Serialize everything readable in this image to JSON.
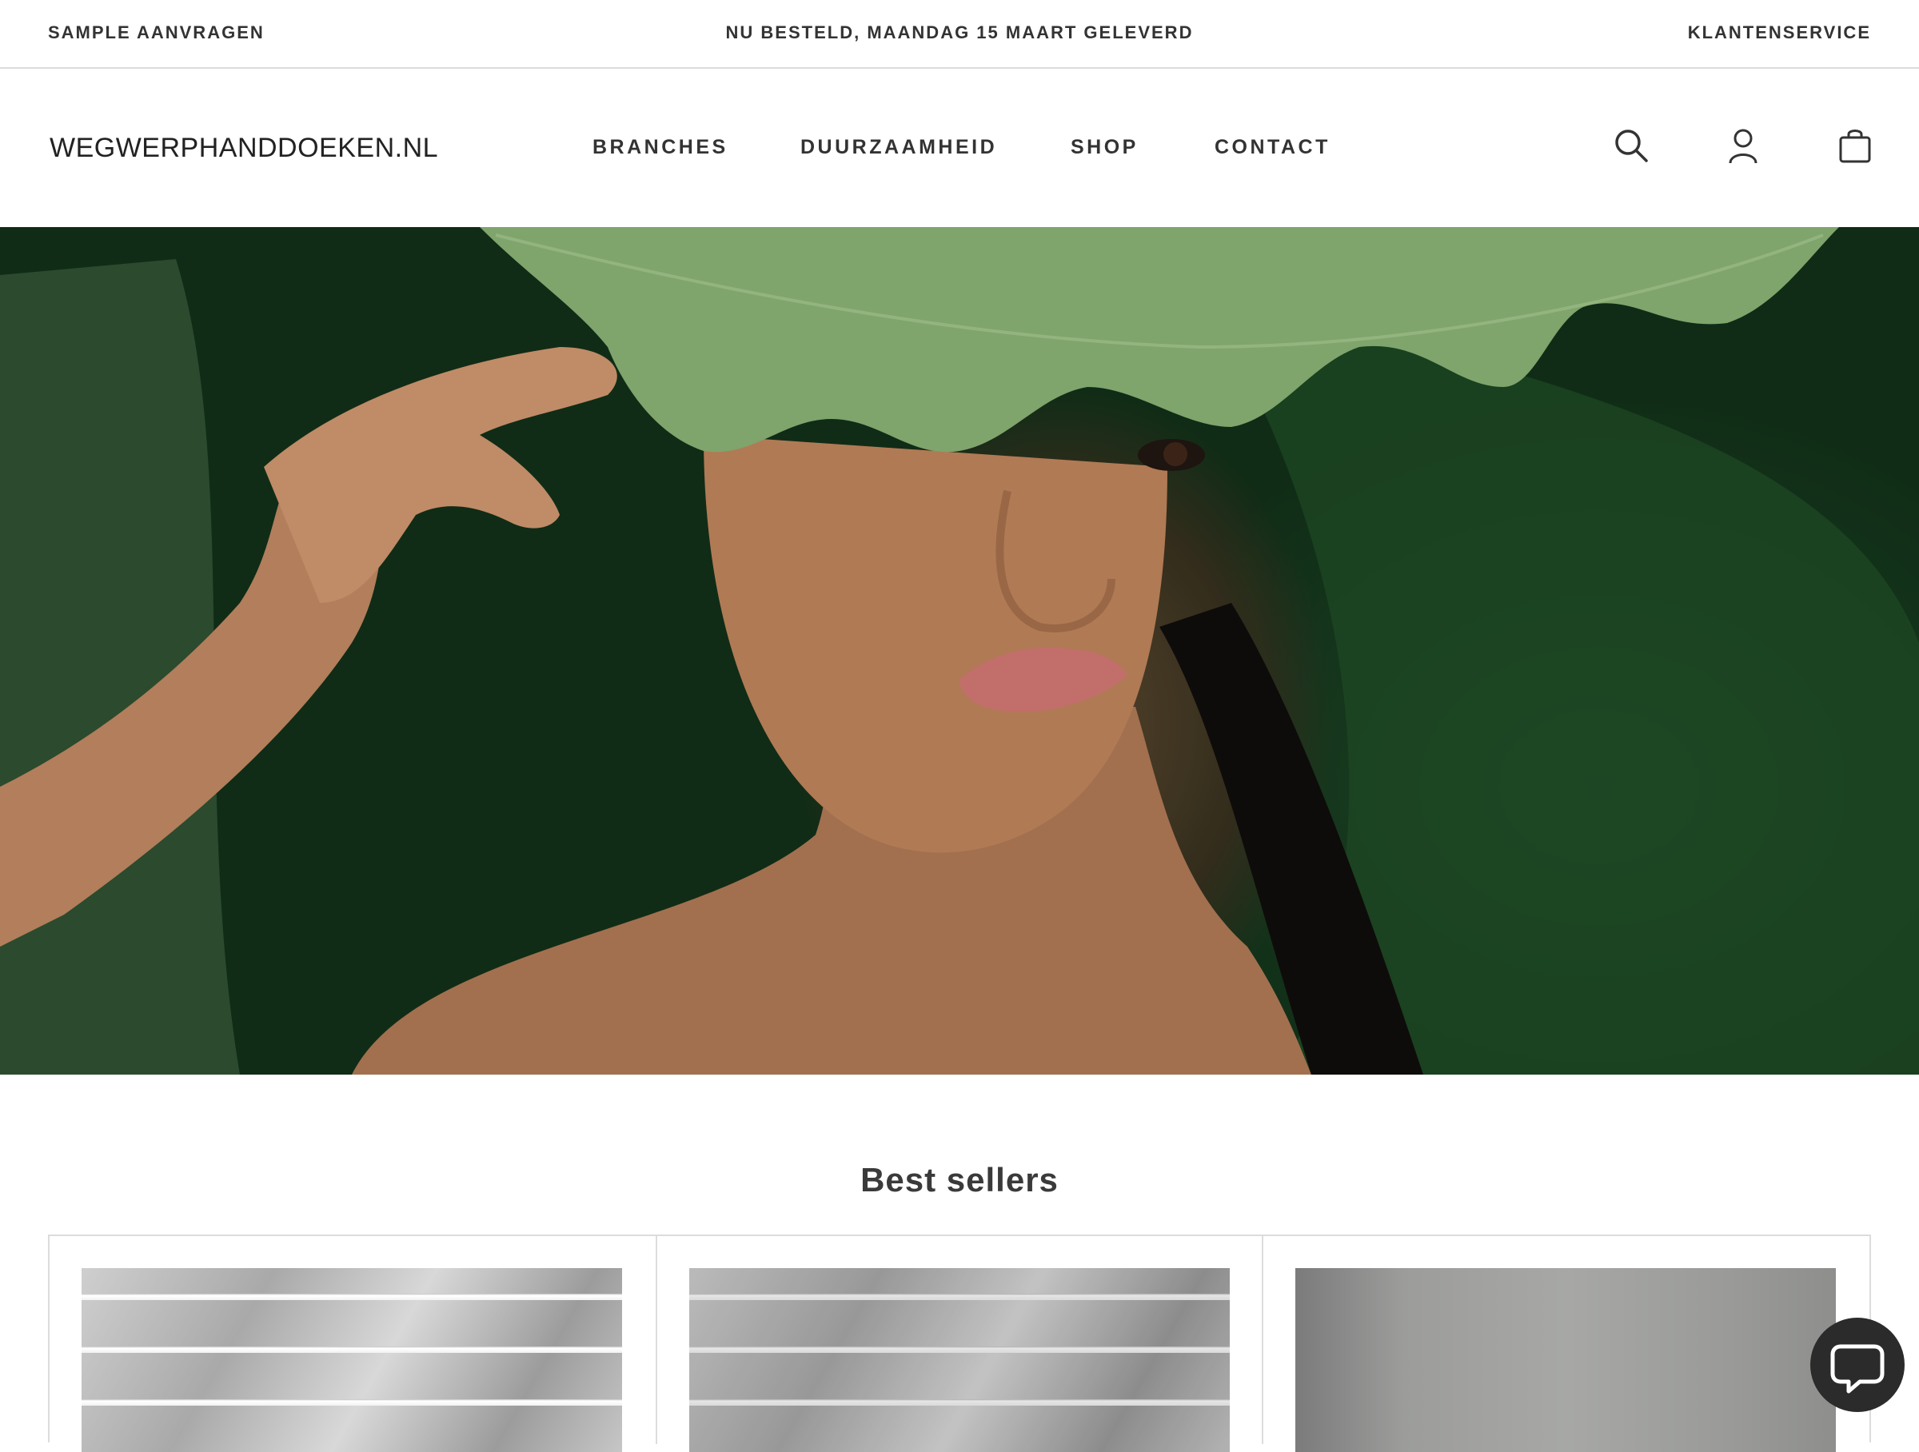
{
  "topbar": {
    "sample": "SAMPLE AANVRAGEN",
    "delivery": "NU BESTELD, MAANDAG 15 MAART GELEVERD",
    "service": "KLANTENSERVICE"
  },
  "header": {
    "logo": "WEGWERPHANDDOEKEN.NL",
    "nav": [
      "BRANCHES",
      "DUURZAAMHEID",
      "SHOP",
      "CONTACT"
    ],
    "icons": [
      "search-icon",
      "account-icon",
      "shopping-bag-icon"
    ]
  },
  "hero": {
    "image": "woman-with-green-leaf"
  },
  "bestsellers": {
    "title": "Best sellers",
    "products": [
      {
        "image": "marble-tiles"
      },
      {
        "image": "marble-tiles"
      },
      {
        "image": "grey-wall"
      }
    ]
  },
  "chat": {
    "icon": "chat-icon"
  },
  "colors": {
    "text": "#333333",
    "border": "#dcdcdc",
    "leaf": "#7fa46c",
    "foliage": "#1a3b1f",
    "lips": "#c9736f",
    "chat_bg": "#2b2b2b"
  }
}
